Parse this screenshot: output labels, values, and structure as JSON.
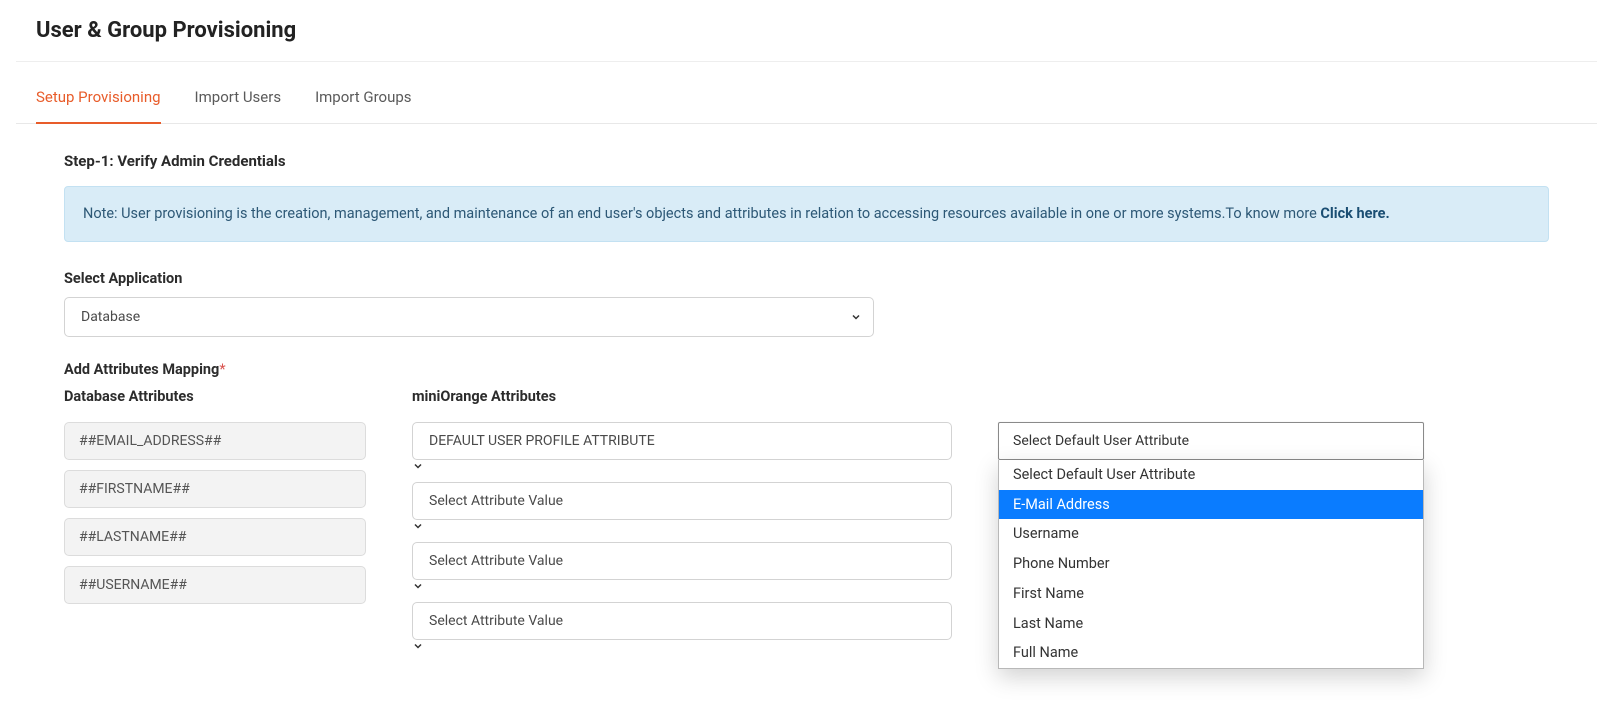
{
  "header": {
    "title": "User & Group Provisioning"
  },
  "tabs": [
    {
      "label": "Setup Provisioning",
      "active": true
    },
    {
      "label": "Import Users",
      "active": false
    },
    {
      "label": "Import Groups",
      "active": false
    }
  ],
  "step": {
    "title": "Step-1: Verify Admin Credentials"
  },
  "note": {
    "text": "Note: User provisioning is the creation, management, and maintenance of an end user's objects and attributes in relation to accessing resources available in one or more systems.To know more ",
    "link_text": "Click here."
  },
  "application": {
    "label": "Select Application",
    "value": "Database"
  },
  "mapping": {
    "label": "Add Attributes Mapping",
    "required_mark": "*",
    "db_header": "Database Attributes",
    "mo_header": "miniOrange Attributes",
    "rows": [
      {
        "db": "##EMAIL_ADDRESS##",
        "mo": "DEFAULT USER PROFILE ATTRIBUTE"
      },
      {
        "db": "##FIRSTNAME##",
        "mo": "Select Attribute Value"
      },
      {
        "db": "##LASTNAME##",
        "mo": "Select Attribute Value"
      },
      {
        "db": "##USERNAME##",
        "mo": "Select Attribute Value"
      }
    ]
  },
  "default_attr": {
    "selected": "Select Default User Attribute",
    "options": [
      "Select Default User Attribute",
      "E-Mail Address",
      "Username",
      "Phone Number",
      "First Name",
      "Last Name",
      "Full Name"
    ],
    "highlight_index": 1
  }
}
